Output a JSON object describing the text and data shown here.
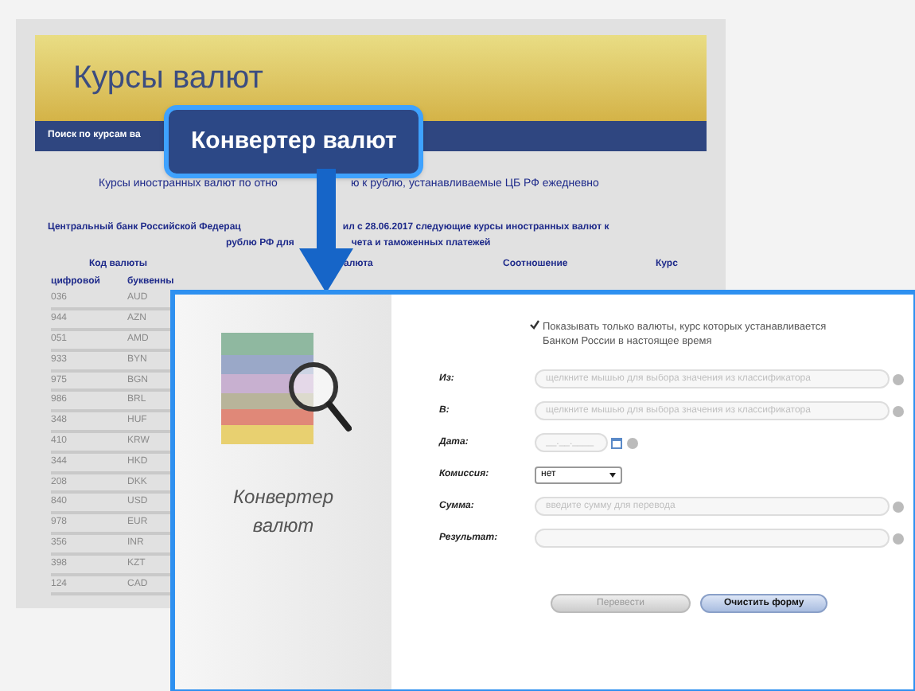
{
  "back_page": {
    "title": "Курсы валют",
    "nav_link": "Поиск по курсам ва",
    "intro_parts": [
      "Курсы иностранных валют по отно",
      "ю к рублю, устанавливаемые ЦБ РФ ежедневно"
    ],
    "notice_line_1_parts": [
      "Центральный банк Российской Федерац",
      "ил с 28.06.2017 следующие курсы иностранных валют к"
    ],
    "notice_line_2_parts": [
      "рублю РФ для",
      "чета и таможенных платежей"
    ],
    "table": {
      "header_group": "Код валюты",
      "columns": [
        "алюта",
        "Соотношение",
        "Курс"
      ],
      "subcolumns": [
        "цифровой",
        "буквенны"
      ],
      "rows": [
        [
          "036",
          "AUD"
        ],
        [
          "944",
          "AZN"
        ],
        [
          "051",
          "AMD"
        ],
        [
          "933",
          "BYN"
        ],
        [
          "975",
          "BGN"
        ],
        [
          "986",
          "BRL"
        ],
        [
          "348",
          "HUF"
        ],
        [
          "410",
          "KRW"
        ],
        [
          "344",
          "HKD"
        ],
        [
          "208",
          "DKK"
        ],
        [
          "840",
          "USD"
        ],
        [
          "978",
          "EUR"
        ],
        [
          "356",
          "INR"
        ],
        [
          "398",
          "KZT"
        ],
        [
          "124",
          "CAD"
        ]
      ]
    }
  },
  "callout": {
    "title": "Конвертер валют"
  },
  "converter": {
    "caption": "Конвертер валют",
    "only_current": {
      "label": "Показывать только валюты, курс которых устанавливается Банком России в настоящее время",
      "checked": true
    },
    "fields": [
      {
        "label": "Из:",
        "kind": "text",
        "placeholder": "щелкните мышью для выбора значения из классификатора"
      },
      {
        "label": "В:",
        "kind": "text",
        "placeholder": "щелкните мышью для выбора значения из классификатора"
      },
      {
        "label": "Дата:",
        "kind": "date",
        "placeholder": "__.__.____"
      },
      {
        "label": "Комиссия:",
        "kind": "select",
        "value": "нет"
      },
      {
        "label": "Сумма:",
        "kind": "text",
        "placeholder": "введите сумму для перевода"
      },
      {
        "label": "Результат:",
        "kind": "text"
      }
    ],
    "buttons": [
      {
        "label": "Перевести",
        "disabled": true
      },
      {
        "label": "Очистить форму",
        "disabled": false
      }
    ]
  }
}
